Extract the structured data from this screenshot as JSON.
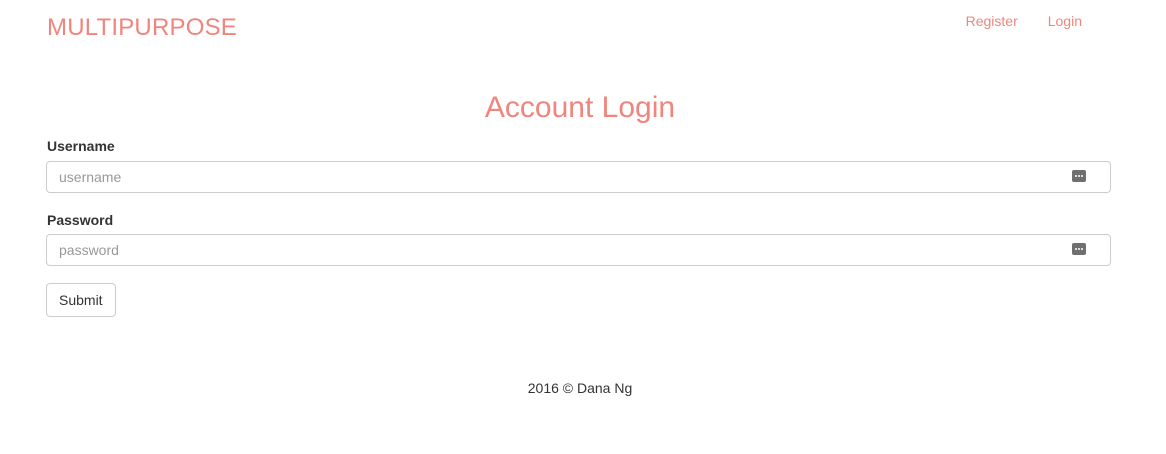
{
  "header": {
    "brand": "MULTIPURPOSE",
    "nav": [
      {
        "label": "Register"
      },
      {
        "label": "Login"
      }
    ]
  },
  "form": {
    "title": "Account Login",
    "username": {
      "label": "Username",
      "placeholder": "username",
      "value": ""
    },
    "password": {
      "label": "Password",
      "placeholder": "password",
      "value": ""
    },
    "submit_label": "Submit"
  },
  "footer": {
    "text": "2016 © Dana Ng"
  },
  "colors": {
    "accent": "#f0857d",
    "text": "#333333",
    "border": "#cccccc"
  },
  "icons": {
    "field_icon": "password-manager-icon"
  }
}
